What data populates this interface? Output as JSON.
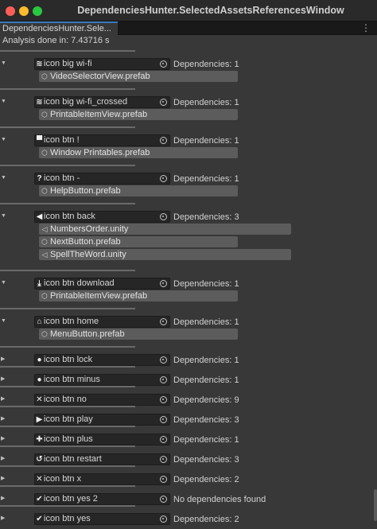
{
  "window": {
    "title": "DependenciesHunter.SelectedAssetsReferencesWindow"
  },
  "tab": {
    "label": "DependenciesHunter.Sele...",
    "menu_icon": "⋮"
  },
  "status": "Analysis done in: 7.43716 s",
  "entries": [
    {
      "expanded": true,
      "icon": "wifi-icon",
      "glyph": "≋",
      "name": "icon big wi-fi",
      "deps": "Dependencies: 1",
      "refs": [
        {
          "type": "prefab",
          "glyph": "⬡",
          "name": "VideoSelectorView.prefab"
        }
      ]
    },
    {
      "expanded": true,
      "icon": "wifi-crossed-icon",
      "glyph": "≋",
      "name": "icon big wi-fi_crossed",
      "deps": "Dependencies: 1",
      "refs": [
        {
          "type": "prefab",
          "glyph": "⬡",
          "name": "PrintableItemView.prefab"
        }
      ]
    },
    {
      "expanded": true,
      "icon": "printer-icon",
      "glyph": "▀",
      "name": "icon btn !",
      "deps": "Dependencies: 1",
      "refs": [
        {
          "type": "prefab",
          "glyph": "⬡",
          "name": "Window Printables.prefab"
        }
      ]
    },
    {
      "expanded": true,
      "icon": "question-icon",
      "glyph": "?",
      "name": "icon btn -",
      "deps": "Dependencies: 1",
      "refs": [
        {
          "type": "prefab",
          "glyph": "⬡",
          "name": "HelpButton.prefab"
        }
      ]
    },
    {
      "expanded": true,
      "icon": "back-arrow-icon",
      "glyph": "◀",
      "name": "icon btn back",
      "deps": "Dependencies: 3",
      "refs": [
        {
          "type": "unity",
          "glyph": "◁",
          "name": "NumbersOrder.unity"
        },
        {
          "type": "prefab",
          "glyph": "⬡",
          "name": "NextButton.prefab"
        },
        {
          "type": "unity",
          "glyph": "◁",
          "name": "SpellTheWord.unity"
        }
      ]
    },
    {
      "expanded": true,
      "icon": "download-icon",
      "glyph": "⤓",
      "name": "icon btn download",
      "deps": "Dependencies: 1",
      "refs": [
        {
          "type": "prefab",
          "glyph": "⬡",
          "name": "PrintableItemView.prefab"
        }
      ]
    },
    {
      "expanded": true,
      "icon": "home-icon",
      "glyph": "⌂",
      "name": "icon btn home",
      "deps": "Dependencies: 1",
      "refs": [
        {
          "type": "prefab",
          "glyph": "⬡",
          "name": "MenuButton.prefab"
        }
      ]
    },
    {
      "expanded": false,
      "icon": "lock-icon",
      "glyph": "●",
      "name": "icon btn lock",
      "deps": "Dependencies: 1",
      "refs": []
    },
    {
      "expanded": false,
      "icon": "minus-icon",
      "glyph": "●",
      "name": "icon btn minus",
      "deps": "Dependencies: 1",
      "refs": []
    },
    {
      "expanded": false,
      "icon": "cross-icon",
      "glyph": "✕",
      "name": "icon btn no",
      "deps": "Dependencies: 9",
      "refs": []
    },
    {
      "expanded": false,
      "icon": "play-icon",
      "glyph": "▶",
      "name": "icon btn play",
      "deps": "Dependencies: 3",
      "refs": []
    },
    {
      "expanded": false,
      "icon": "plus-icon",
      "glyph": "✚",
      "name": "icon btn plus",
      "deps": "Dependencies: 1",
      "refs": []
    },
    {
      "expanded": false,
      "icon": "restart-icon",
      "glyph": "↺",
      "name": "icon btn restart",
      "deps": "Dependencies: 3",
      "refs": []
    },
    {
      "expanded": false,
      "icon": "cross-icon",
      "glyph": "✕",
      "name": "icon btn x",
      "deps": "Dependencies: 2",
      "refs": []
    },
    {
      "expanded": false,
      "icon": "check-icon",
      "glyph": "✔",
      "name": "icon btn yes 2",
      "deps": "No dependencies found",
      "refs": []
    },
    {
      "expanded": false,
      "icon": "check-icon",
      "glyph": "✔",
      "name": "icon btn yes",
      "deps": "Dependencies: 2",
      "refs": []
    }
  ]
}
